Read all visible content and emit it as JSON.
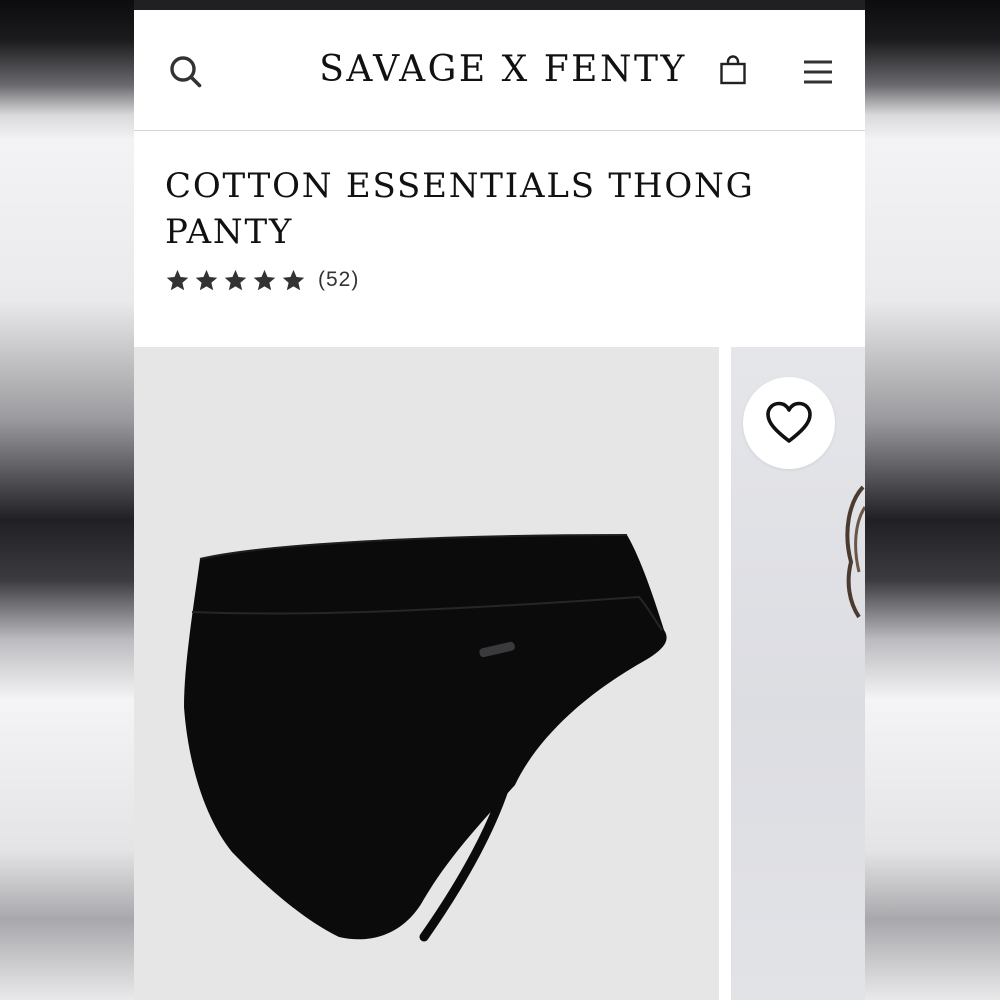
{
  "header": {
    "brand": "SAVAGE X FENTY",
    "search_icon": "search-icon",
    "bag_icon": "shopping-bag-icon",
    "menu_icon": "hamburger-menu-icon"
  },
  "product": {
    "title": "COTTON ESSENTIALS THONG PANTY",
    "rating_value": 5,
    "rating_max": 5,
    "review_count": "(52)"
  },
  "gallery": {
    "wishlist_icon": "heart-icon",
    "main_image": "black cotton thong panty product photo",
    "next_image": "model photo (partially visible)"
  },
  "colors": {
    "text": "#111111",
    "star": "#333333",
    "image_bg": "#e6e6e6",
    "header_border": "#d4d4d4"
  }
}
